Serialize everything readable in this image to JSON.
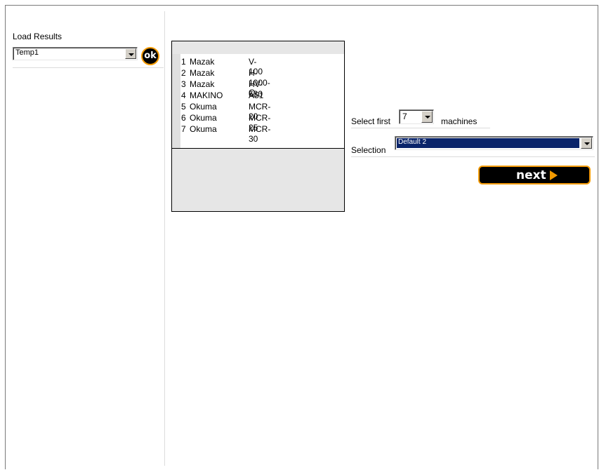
{
  "load_panel": {
    "label": "Load Results",
    "selected": "Temp1",
    "ok_label": "ok"
  },
  "machines": [
    {
      "num": "1",
      "make": "Mazak",
      "model": "V-100"
    },
    {
      "num": "2",
      "make": "Mazak",
      "model": "H-1000-Q"
    },
    {
      "num": "3",
      "make": "Mazak",
      "model": "HV-630"
    },
    {
      "num": "4",
      "make": "MAKINO",
      "model": "A51"
    },
    {
      "num": "5",
      "make": "Okuma",
      "model": "MCR-20"
    },
    {
      "num": "6",
      "make": "Okuma",
      "model": "MCR-25"
    },
    {
      "num": "7",
      "make": "Okuma",
      "model": "MCR-30"
    }
  ],
  "select_first": {
    "prefix": "Select first",
    "value": "7",
    "suffix": "machines"
  },
  "selection": {
    "label": "Selection",
    "value": "Default 2"
  },
  "next_button": {
    "label": "next",
    "icon": "play-triangle-icon"
  },
  "colors": {
    "accent": "#f39a00",
    "button_bg": "#000000",
    "highlight": "#0a246a"
  }
}
